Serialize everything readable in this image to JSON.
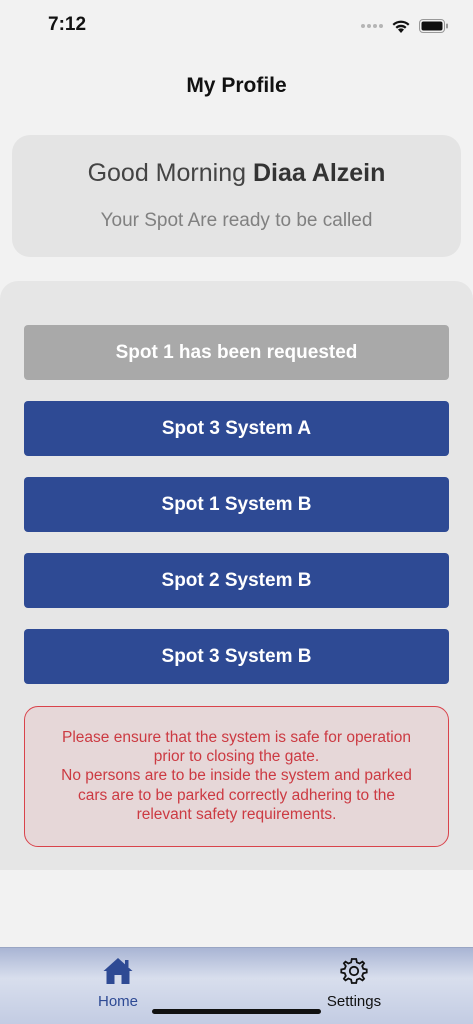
{
  "status_bar": {
    "time": "7:12"
  },
  "nav": {
    "title": "My Profile"
  },
  "greeting": {
    "prefix": "Good Morning ",
    "name": "Diaa Alzein",
    "subtitle": "Your Spot Are ready to be called"
  },
  "spots": [
    {
      "label": "Spot 1 has been requested",
      "state": "requested"
    },
    {
      "label": "Spot 3 System A",
      "state": "available"
    },
    {
      "label": "Spot 1 System B",
      "state": "available"
    },
    {
      "label": "Spot 2 System B",
      "state": "available"
    },
    {
      "label": "Spot 3 System B",
      "state": "available"
    }
  ],
  "warning": {
    "lines": [
      "Please ensure that the system is safe for operation",
      "prior to closing the gate.",
      "No persons are to be inside the system and parked",
      "cars are to be parked correctly adhering to the",
      "relevant safety requirements."
    ]
  },
  "tab_bar": {
    "home": {
      "label": "Home",
      "icon": "house-icon"
    },
    "settings": {
      "label": "Settings",
      "icon": "gear-icon"
    }
  },
  "colors": {
    "accent": "#2e4a94",
    "requested": "#a9a9a9",
    "warning": "#cc3a42"
  }
}
